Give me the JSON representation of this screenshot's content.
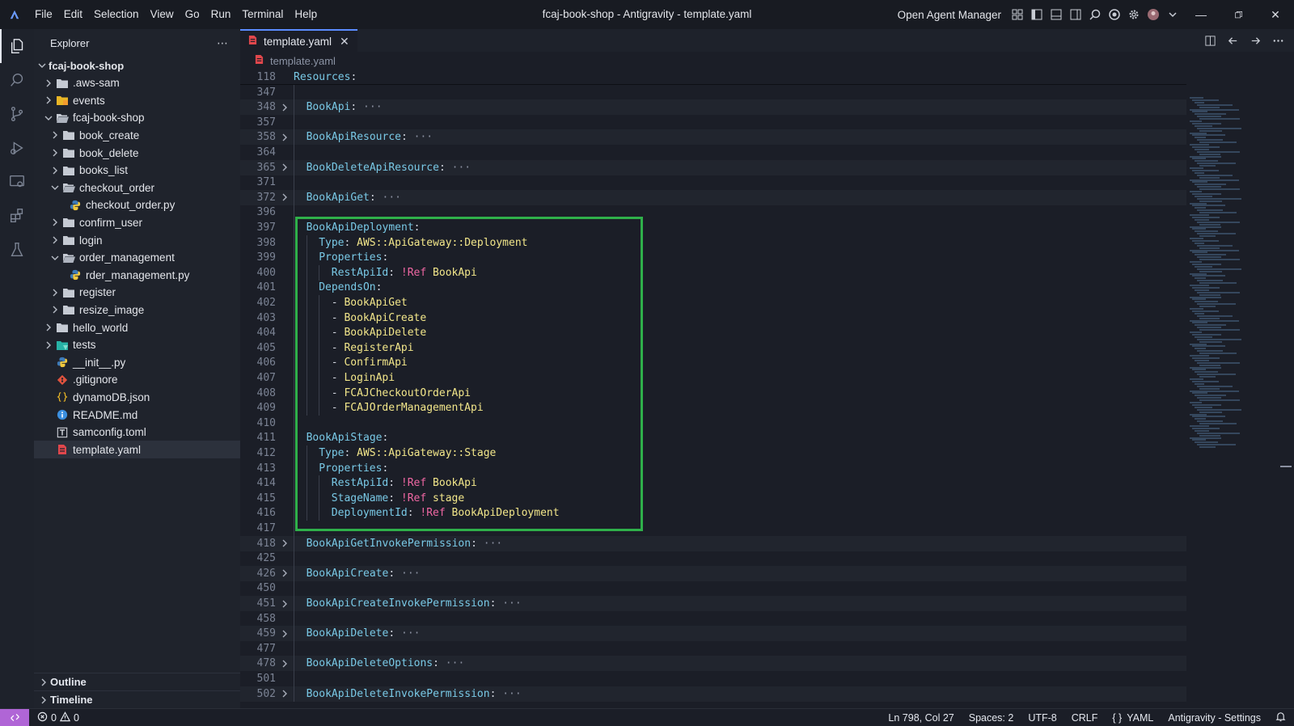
{
  "menu": [
    "File",
    "Edit",
    "Selection",
    "View",
    "Go",
    "Run",
    "Terminal",
    "Help"
  ],
  "window_title": "fcaj-book-shop - Antigravity - template.yaml",
  "agent_manager_label": "Open Agent Manager",
  "sidebar": {
    "title": "Explorer",
    "tree": [
      {
        "label": "fcaj-book-shop",
        "depth": 0,
        "expanded": true,
        "type": "root",
        "bold": true
      },
      {
        "label": ".aws-sam",
        "depth": 1,
        "expanded": false,
        "type": "folder"
      },
      {
        "label": "events",
        "depth": 1,
        "expanded": false,
        "type": "folder-yellow"
      },
      {
        "label": "fcaj-book-shop",
        "depth": 1,
        "expanded": true,
        "type": "folder-open"
      },
      {
        "label": "book_create",
        "depth": 2,
        "expanded": false,
        "type": "folder"
      },
      {
        "label": "book_delete",
        "depth": 2,
        "expanded": false,
        "type": "folder"
      },
      {
        "label": "books_list",
        "depth": 2,
        "expanded": false,
        "type": "folder"
      },
      {
        "label": "checkout_order",
        "depth": 2,
        "expanded": true,
        "type": "folder-open"
      },
      {
        "label": "checkout_order.py",
        "depth": 3,
        "type": "python"
      },
      {
        "label": "confirm_user",
        "depth": 2,
        "expanded": false,
        "type": "folder"
      },
      {
        "label": "login",
        "depth": 2,
        "expanded": false,
        "type": "folder"
      },
      {
        "label": "order_management",
        "depth": 2,
        "expanded": true,
        "type": "folder-open"
      },
      {
        "label": "rder_management.py",
        "depth": 3,
        "type": "python"
      },
      {
        "label": "register",
        "depth": 2,
        "expanded": false,
        "type": "folder"
      },
      {
        "label": "resize_image",
        "depth": 2,
        "expanded": false,
        "type": "folder"
      },
      {
        "label": "hello_world",
        "depth": 1,
        "expanded": false,
        "type": "folder"
      },
      {
        "label": "tests",
        "depth": 1,
        "expanded": false,
        "type": "folder-teal"
      },
      {
        "label": "__init__.py",
        "depth": 1,
        "type": "python"
      },
      {
        "label": ".gitignore",
        "depth": 1,
        "type": "git"
      },
      {
        "label": "dynamoDB.json",
        "depth": 1,
        "type": "json"
      },
      {
        "label": "README.md",
        "depth": 1,
        "type": "info"
      },
      {
        "label": "samconfig.toml",
        "depth": 1,
        "type": "toml"
      },
      {
        "label": "template.yaml",
        "depth": 1,
        "type": "yaml",
        "selected": true
      }
    ],
    "panels": [
      "Outline",
      "Timeline"
    ]
  },
  "editor": {
    "tab_label": "template.yaml",
    "breadcrumb": "template.yaml",
    "lines": [
      {
        "n": "118",
        "sticky": true,
        "tokens": [
          [
            "k",
            "Resources"
          ],
          [
            "p",
            ":"
          ]
        ]
      },
      {
        "n": "347",
        "tokens": []
      },
      {
        "n": "348",
        "fold": true,
        "indent": 1,
        "tokens": [
          [
            "k",
            "BookApi"
          ],
          [
            "p",
            ":"
          ],
          [
            "dim",
            " ···"
          ]
        ]
      },
      {
        "n": "357",
        "tokens": []
      },
      {
        "n": "358",
        "fold": true,
        "indent": 1,
        "tokens": [
          [
            "k",
            "BookApiResource"
          ],
          [
            "p",
            ":"
          ],
          [
            "dim",
            " ···"
          ]
        ]
      },
      {
        "n": "364",
        "tokens": []
      },
      {
        "n": "365",
        "fold": true,
        "indent": 1,
        "tokens": [
          [
            "k",
            "BookDeleteApiResource"
          ],
          [
            "p",
            ":"
          ],
          [
            "dim",
            " ···"
          ]
        ]
      },
      {
        "n": "371",
        "tokens": []
      },
      {
        "n": "372",
        "fold": true,
        "indent": 1,
        "tokens": [
          [
            "k",
            "BookApiGet"
          ],
          [
            "p",
            ":"
          ],
          [
            "dim",
            " ···"
          ]
        ]
      },
      {
        "n": "396",
        "tokens": []
      },
      {
        "n": "397",
        "indent": 1,
        "tokens": [
          [
            "k",
            "BookApiDeployment"
          ],
          [
            "p",
            ":"
          ]
        ]
      },
      {
        "n": "398",
        "indent": 2,
        "tokens": [
          [
            "k",
            "Type"
          ],
          [
            "p",
            ": "
          ],
          [
            "v",
            "AWS::ApiGateway::Deployment"
          ]
        ]
      },
      {
        "n": "399",
        "indent": 2,
        "tokens": [
          [
            "k",
            "Properties"
          ],
          [
            "p",
            ":"
          ]
        ]
      },
      {
        "n": "400",
        "indent": 3,
        "tokens": [
          [
            "k",
            "RestApiId"
          ],
          [
            "p",
            ": "
          ],
          [
            "t",
            "!Ref "
          ],
          [
            "v",
            "BookApi"
          ]
        ]
      },
      {
        "n": "401",
        "indent": 2,
        "tokens": [
          [
            "k",
            "DependsOn"
          ],
          [
            "p",
            ":"
          ]
        ]
      },
      {
        "n": "402",
        "indent": 3,
        "tokens": [
          [
            "p",
            "- "
          ],
          [
            "v",
            "BookApiGet"
          ]
        ]
      },
      {
        "n": "403",
        "indent": 3,
        "tokens": [
          [
            "p",
            "- "
          ],
          [
            "v",
            "BookApiCreate"
          ]
        ]
      },
      {
        "n": "404",
        "indent": 3,
        "tokens": [
          [
            "p",
            "- "
          ],
          [
            "v",
            "BookApiDelete"
          ]
        ]
      },
      {
        "n": "405",
        "indent": 3,
        "tokens": [
          [
            "p",
            "- "
          ],
          [
            "v",
            "RegisterApi"
          ]
        ]
      },
      {
        "n": "406",
        "indent": 3,
        "tokens": [
          [
            "p",
            "- "
          ],
          [
            "v",
            "ConfirmApi"
          ]
        ]
      },
      {
        "n": "407",
        "indent": 3,
        "tokens": [
          [
            "p",
            "- "
          ],
          [
            "v",
            "LoginApi"
          ]
        ]
      },
      {
        "n": "408",
        "indent": 3,
        "tokens": [
          [
            "p",
            "- "
          ],
          [
            "v",
            "FCAJCheckoutOrderApi"
          ]
        ]
      },
      {
        "n": "409",
        "indent": 3,
        "tokens": [
          [
            "p",
            "- "
          ],
          [
            "v",
            "FCAJOrderManagementApi"
          ]
        ]
      },
      {
        "n": "410",
        "tokens": []
      },
      {
        "n": "411",
        "indent": 1,
        "tokens": [
          [
            "k",
            "BookApiStage"
          ],
          [
            "p",
            ":"
          ]
        ]
      },
      {
        "n": "412",
        "indent": 2,
        "tokens": [
          [
            "k",
            "Type"
          ],
          [
            "p",
            ": "
          ],
          [
            "v",
            "AWS::ApiGateway::Stage"
          ]
        ]
      },
      {
        "n": "413",
        "indent": 2,
        "tokens": [
          [
            "k",
            "Properties"
          ],
          [
            "p",
            ":"
          ]
        ]
      },
      {
        "n": "414",
        "indent": 3,
        "tokens": [
          [
            "k",
            "RestApiId"
          ],
          [
            "p",
            ": "
          ],
          [
            "t",
            "!Ref "
          ],
          [
            "v",
            "BookApi"
          ]
        ]
      },
      {
        "n": "415",
        "indent": 3,
        "tokens": [
          [
            "k",
            "StageName"
          ],
          [
            "p",
            ": "
          ],
          [
            "t",
            "!Ref "
          ],
          [
            "v",
            "stage"
          ]
        ]
      },
      {
        "n": "416",
        "indent": 3,
        "tokens": [
          [
            "k",
            "DeploymentId"
          ],
          [
            "p",
            ": "
          ],
          [
            "t",
            "!Ref "
          ],
          [
            "v",
            "BookApiDeployment"
          ]
        ]
      },
      {
        "n": "417",
        "tokens": []
      },
      {
        "n": "418",
        "fold": true,
        "indent": 1,
        "tokens": [
          [
            "k",
            "BookApiGetInvokePermission"
          ],
          [
            "p",
            ":"
          ],
          [
            "dim",
            " ···"
          ]
        ]
      },
      {
        "n": "425",
        "tokens": []
      },
      {
        "n": "426",
        "fold": true,
        "indent": 1,
        "tokens": [
          [
            "k",
            "BookApiCreate"
          ],
          [
            "p",
            ":"
          ],
          [
            "dim",
            " ···"
          ]
        ]
      },
      {
        "n": "450",
        "tokens": []
      },
      {
        "n": "451",
        "fold": true,
        "indent": 1,
        "tokens": [
          [
            "k",
            "BookApiCreateInvokePermission"
          ],
          [
            "p",
            ":"
          ],
          [
            "dim",
            " ···"
          ]
        ]
      },
      {
        "n": "458",
        "tokens": []
      },
      {
        "n": "459",
        "fold": true,
        "indent": 1,
        "tokens": [
          [
            "k",
            "BookApiDelete"
          ],
          [
            "p",
            ":"
          ],
          [
            "dim",
            " ···"
          ]
        ]
      },
      {
        "n": "477",
        "tokens": []
      },
      {
        "n": "478",
        "fold": true,
        "indent": 1,
        "tokens": [
          [
            "k",
            "BookApiDeleteOptions"
          ],
          [
            "p",
            ":"
          ],
          [
            "dim",
            " ···"
          ]
        ]
      },
      {
        "n": "501",
        "tokens": []
      },
      {
        "n": "502",
        "fold": true,
        "indent": 1,
        "tokens": [
          [
            "k",
            "BookApiDeleteInvokePermission"
          ],
          [
            "p",
            ":"
          ],
          [
            "dim",
            " ···"
          ]
        ]
      }
    ]
  },
  "status": {
    "errors": "0",
    "warnings": "0",
    "position": "Ln 798, Col 27",
    "spaces": "Spaces: 2",
    "encoding": "UTF-8",
    "eol": "CRLF",
    "language": "YAML",
    "settings": "Antigravity - Settings"
  },
  "colors": {
    "accent": "#5b8cff",
    "highlight_box": "#2fb04a",
    "remote_button": "#b065d6",
    "yaml_key": "#79c9e6",
    "yaml_value": "#f2e68a",
    "yaml_tag": "#ef67a3"
  }
}
